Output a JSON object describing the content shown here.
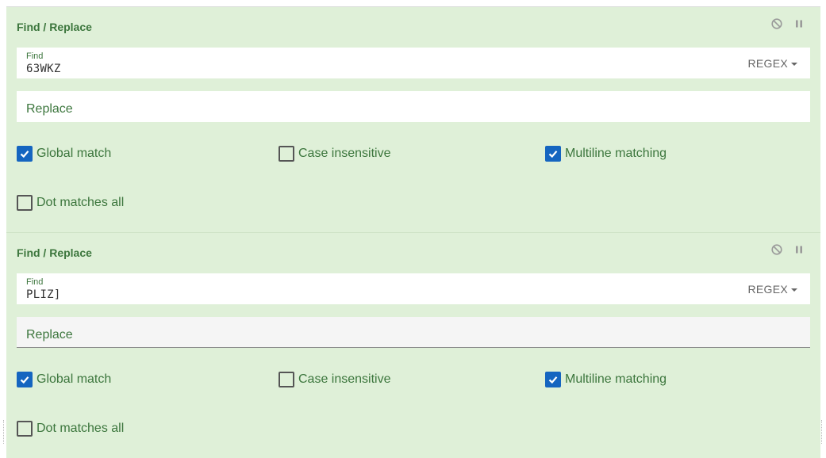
{
  "operations": [
    {
      "title": "Find / Replace",
      "find": {
        "label": "Find",
        "value": "63WKZ"
      },
      "regex_label": "REGEX",
      "replace": {
        "placeholder": "Replace",
        "value": ""
      },
      "options": {
        "global_match": {
          "label": "Global match",
          "checked": true
        },
        "case_insensitive": {
          "label": "Case insensitive",
          "checked": false
        },
        "multiline": {
          "label": "Multiline matching",
          "checked": true
        },
        "dot_all": {
          "label": "Dot matches all",
          "checked": false
        }
      }
    },
    {
      "title": "Find / Replace",
      "find": {
        "label": "Find",
        "value": "PLIZ]"
      },
      "regex_label": "REGEX",
      "replace": {
        "placeholder": "Replace",
        "value": ""
      },
      "options": {
        "global_match": {
          "label": "Global match",
          "checked": true
        },
        "case_insensitive": {
          "label": "Case insensitive",
          "checked": false
        },
        "multiline": {
          "label": "Multiline matching",
          "checked": true
        },
        "dot_all": {
          "label": "Dot matches all",
          "checked": false
        }
      }
    }
  ],
  "icons": {
    "disable": "disable-icon",
    "pause": "pause-icon"
  },
  "colors": {
    "panel_bg": "#dff0d8",
    "text_green": "#3c763d",
    "checkbox_blue": "#1565c0"
  }
}
